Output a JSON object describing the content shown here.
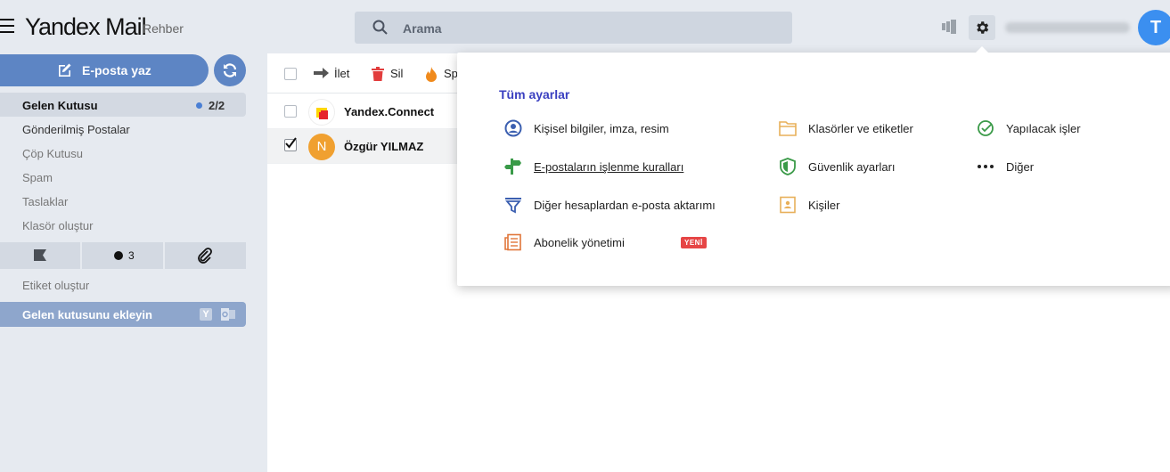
{
  "header": {
    "logo_brand": "Yandex",
    "logo_product": "Mail",
    "rehber": "Rehber",
    "search_placeholder": "Arama",
    "avatar_letter": "T"
  },
  "sidebar": {
    "compose_label": "E-posta yaz",
    "folders": [
      {
        "label": "Gelen Kutusu",
        "count": "2/2"
      },
      {
        "label": "Gönderilmiş Postalar"
      },
      {
        "label": "Çöp Kutusu"
      },
      {
        "label": "Spam"
      },
      {
        "label": "Taslaklar"
      },
      {
        "label": "Klasör oluştur"
      }
    ],
    "unread_filter_count": "3",
    "create_label": "Etiket oluştur",
    "add_inbox_label": "Gelen kutusunu ekleyin",
    "add_inbox_y": "Y"
  },
  "toolbar": {
    "forward": "İlet",
    "delete": "Sil",
    "spam": "Sp"
  },
  "messages": [
    {
      "sender": "Yandex.Connect",
      "selected": false
    },
    {
      "sender": "Özgür YILMAZ",
      "avatar": "N",
      "selected": true
    }
  ],
  "settings_menu": {
    "title": "Tüm ayarlar",
    "items": {
      "personal": "Kişisel bilgiler, imza, resim",
      "rules": "E-postaların işlenme kuralları",
      "import": "Diğer hesaplardan e-posta aktarımı",
      "subscriptions": "Abonelik yönetimi",
      "subscriptions_badge": "YENİ",
      "folders": "Klasörler ve etiketler",
      "security": "Güvenlik ayarları",
      "contacts": "Kişiler",
      "todo": "Yapılacak işler",
      "other": "Diğer"
    }
  },
  "colors": {
    "accent": "#5d85c4",
    "title_blue": "#3a3fc0",
    "avatar_blue": "#3b8ff0",
    "avatar_orange": "#f0a030",
    "badge_red": "#e64545"
  }
}
